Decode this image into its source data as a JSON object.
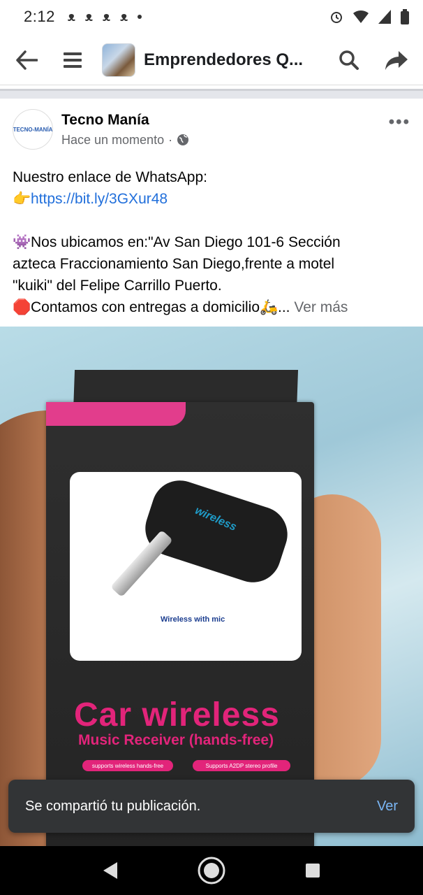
{
  "status_bar": {
    "time": "2:12",
    "notification_icons": [
      "bird-icon",
      "bird-icon",
      "bird-icon",
      "bird-icon"
    ],
    "right_icons": [
      "alarm-icon",
      "wifi-icon",
      "signal-icon",
      "battery-icon"
    ]
  },
  "header": {
    "title": "Emprendedores Q...",
    "back_icon": "arrow-left-icon",
    "menu_icon": "hamburger-icon",
    "search_icon": "search-icon",
    "share_icon": "share-icon"
  },
  "post": {
    "author": "Tecno Manía",
    "avatar_text": "TECNO-MANÍA",
    "timestamp": "Hace un momento",
    "separator": "·",
    "privacy_icon": "globe-icon",
    "line1": "Nuestro enlace de WhatsApp:",
    "link_emoji": "👉",
    "link": "https://bit.ly/3GXur48",
    "location_emoji": "👾",
    "location_text_1": "Nos ubicamos en:\"Av San Diego 101-6 Sección",
    "location_text_2": "azteca Fraccionamiento San Diego,frente a motel",
    "location_text_3": "\"kuiki\" del Felipe Carrillo Puerto.",
    "delivery_emoji": "🛑",
    "delivery_text": "Contamos con entregas a domicilio",
    "delivery_emoji2": "🛵",
    "ellipsis": "...",
    "see_more": "Ver más"
  },
  "photo": {
    "device_label": "wireless",
    "logo_caption": "Wireless with mic",
    "headline_1": "Car  wireless",
    "headline_2": "Music Receiver (hands-free)",
    "pill_1": "supports wireless hands-free",
    "pill_2": "Supports A2DP stereo profile"
  },
  "snackbar": {
    "message": "Se compartió tu publicación.",
    "action": "Ver"
  },
  "nav": {
    "back_icon": "triangle-back-icon",
    "home_icon": "circle-home-icon",
    "recents_icon": "square-recents-icon"
  }
}
